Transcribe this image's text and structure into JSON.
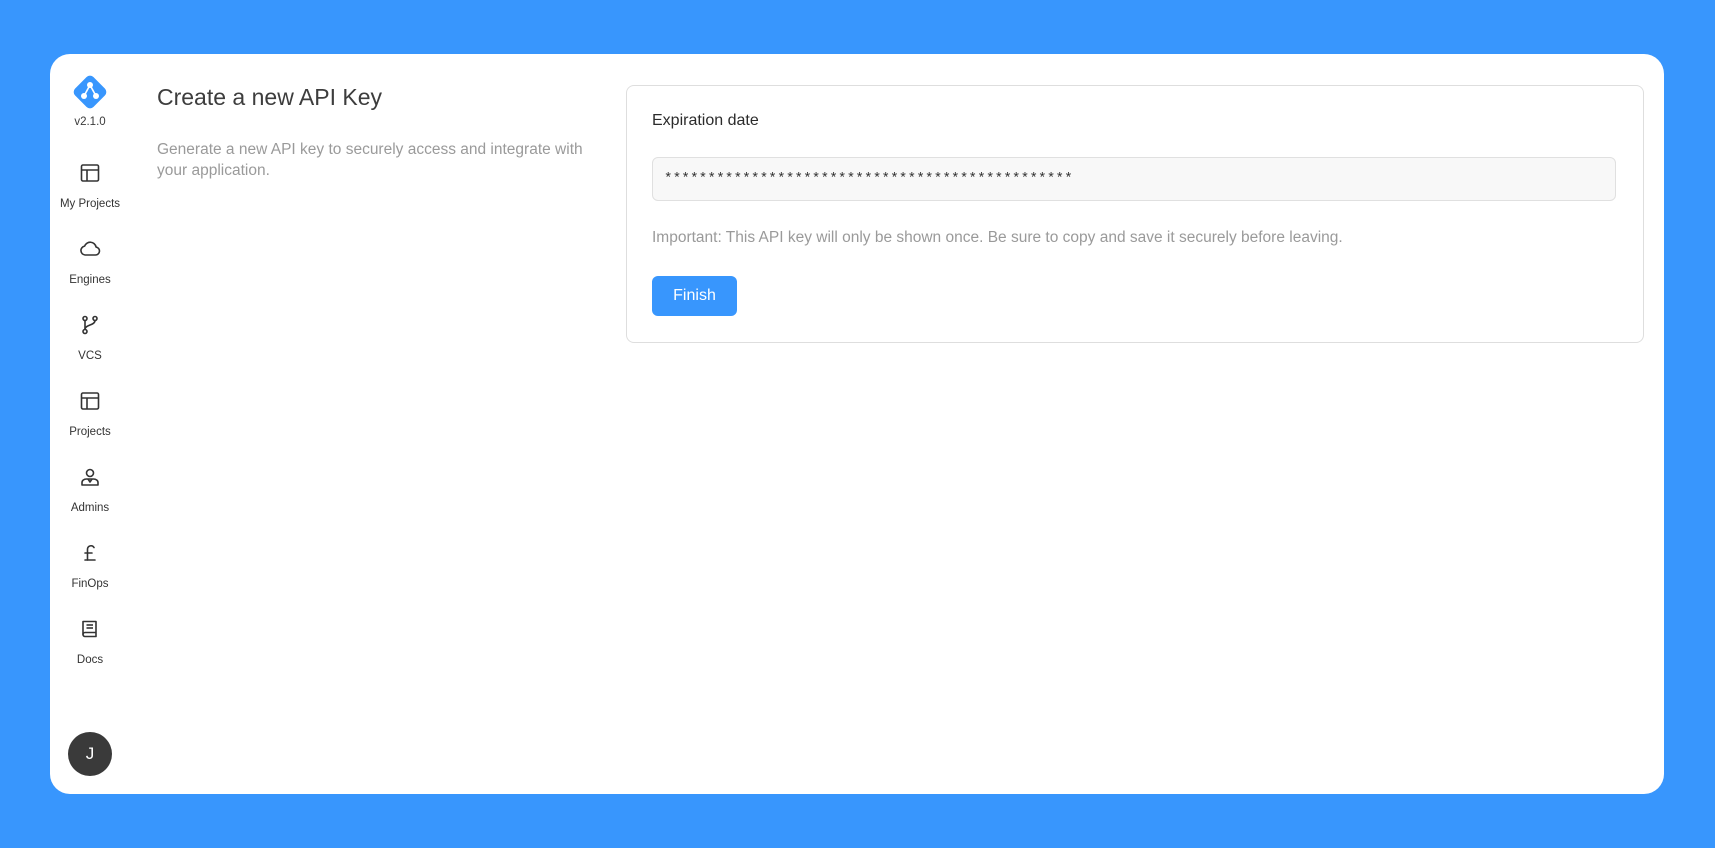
{
  "app": {
    "version": "v2.1.0",
    "brand_color": "#3896fd",
    "logo_icon": "diamond-network-logo"
  },
  "sidebar": {
    "items": [
      {
        "label": "My Projects",
        "icon": "layout-icon"
      },
      {
        "label": "Engines",
        "icon": "cloud-icon"
      },
      {
        "label": "VCS",
        "icon": "git-branch-icon"
      },
      {
        "label": "Projects",
        "icon": "layout-icon"
      },
      {
        "label": "Admins",
        "icon": "admin-user-icon"
      },
      {
        "label": "FinOps",
        "icon": "pound-icon"
      },
      {
        "label": "Docs",
        "icon": "book-icon"
      }
    ],
    "avatar_initial": "J"
  },
  "header": {
    "title": "Create a new API Key",
    "description": "Generate a new API key to securely access and integrate with your application."
  },
  "form": {
    "field_label": "Expiration date",
    "key_value": "***********************************************",
    "note": "Important: This API key will only be shown once. Be sure to copy and save it securely before leaving.",
    "finish_label": "Finish"
  }
}
